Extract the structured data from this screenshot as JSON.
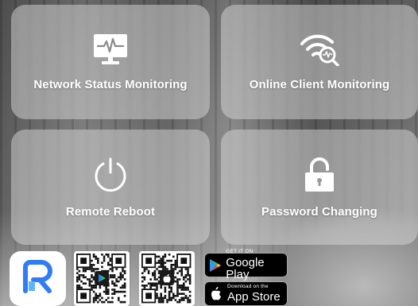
{
  "tiles": {
    "network": {
      "label": "Network Status Monitoring",
      "icon": "monitor-heartbeat-icon"
    },
    "client": {
      "label": "Online Client Monitoring",
      "icon": "wifi-search-icon"
    },
    "reboot": {
      "label": "Remote Reboot",
      "icon": "power-icon"
    },
    "password": {
      "label": "Password Changing",
      "icon": "padlock-icon"
    }
  },
  "downloads": {
    "app_logo": {
      "icon": "app-logo-icon",
      "color": "#2f7cf6"
    },
    "qr_android": {
      "icon": "google-play-qr-icon"
    },
    "qr_ios": {
      "icon": "apple-qr-icon"
    },
    "google_play": {
      "small": "GET IT ON",
      "big": "Google Play",
      "icon": "google-play-icon"
    },
    "app_store": {
      "small": "Download on the",
      "big": "App Store",
      "icon": "apple-icon"
    }
  }
}
